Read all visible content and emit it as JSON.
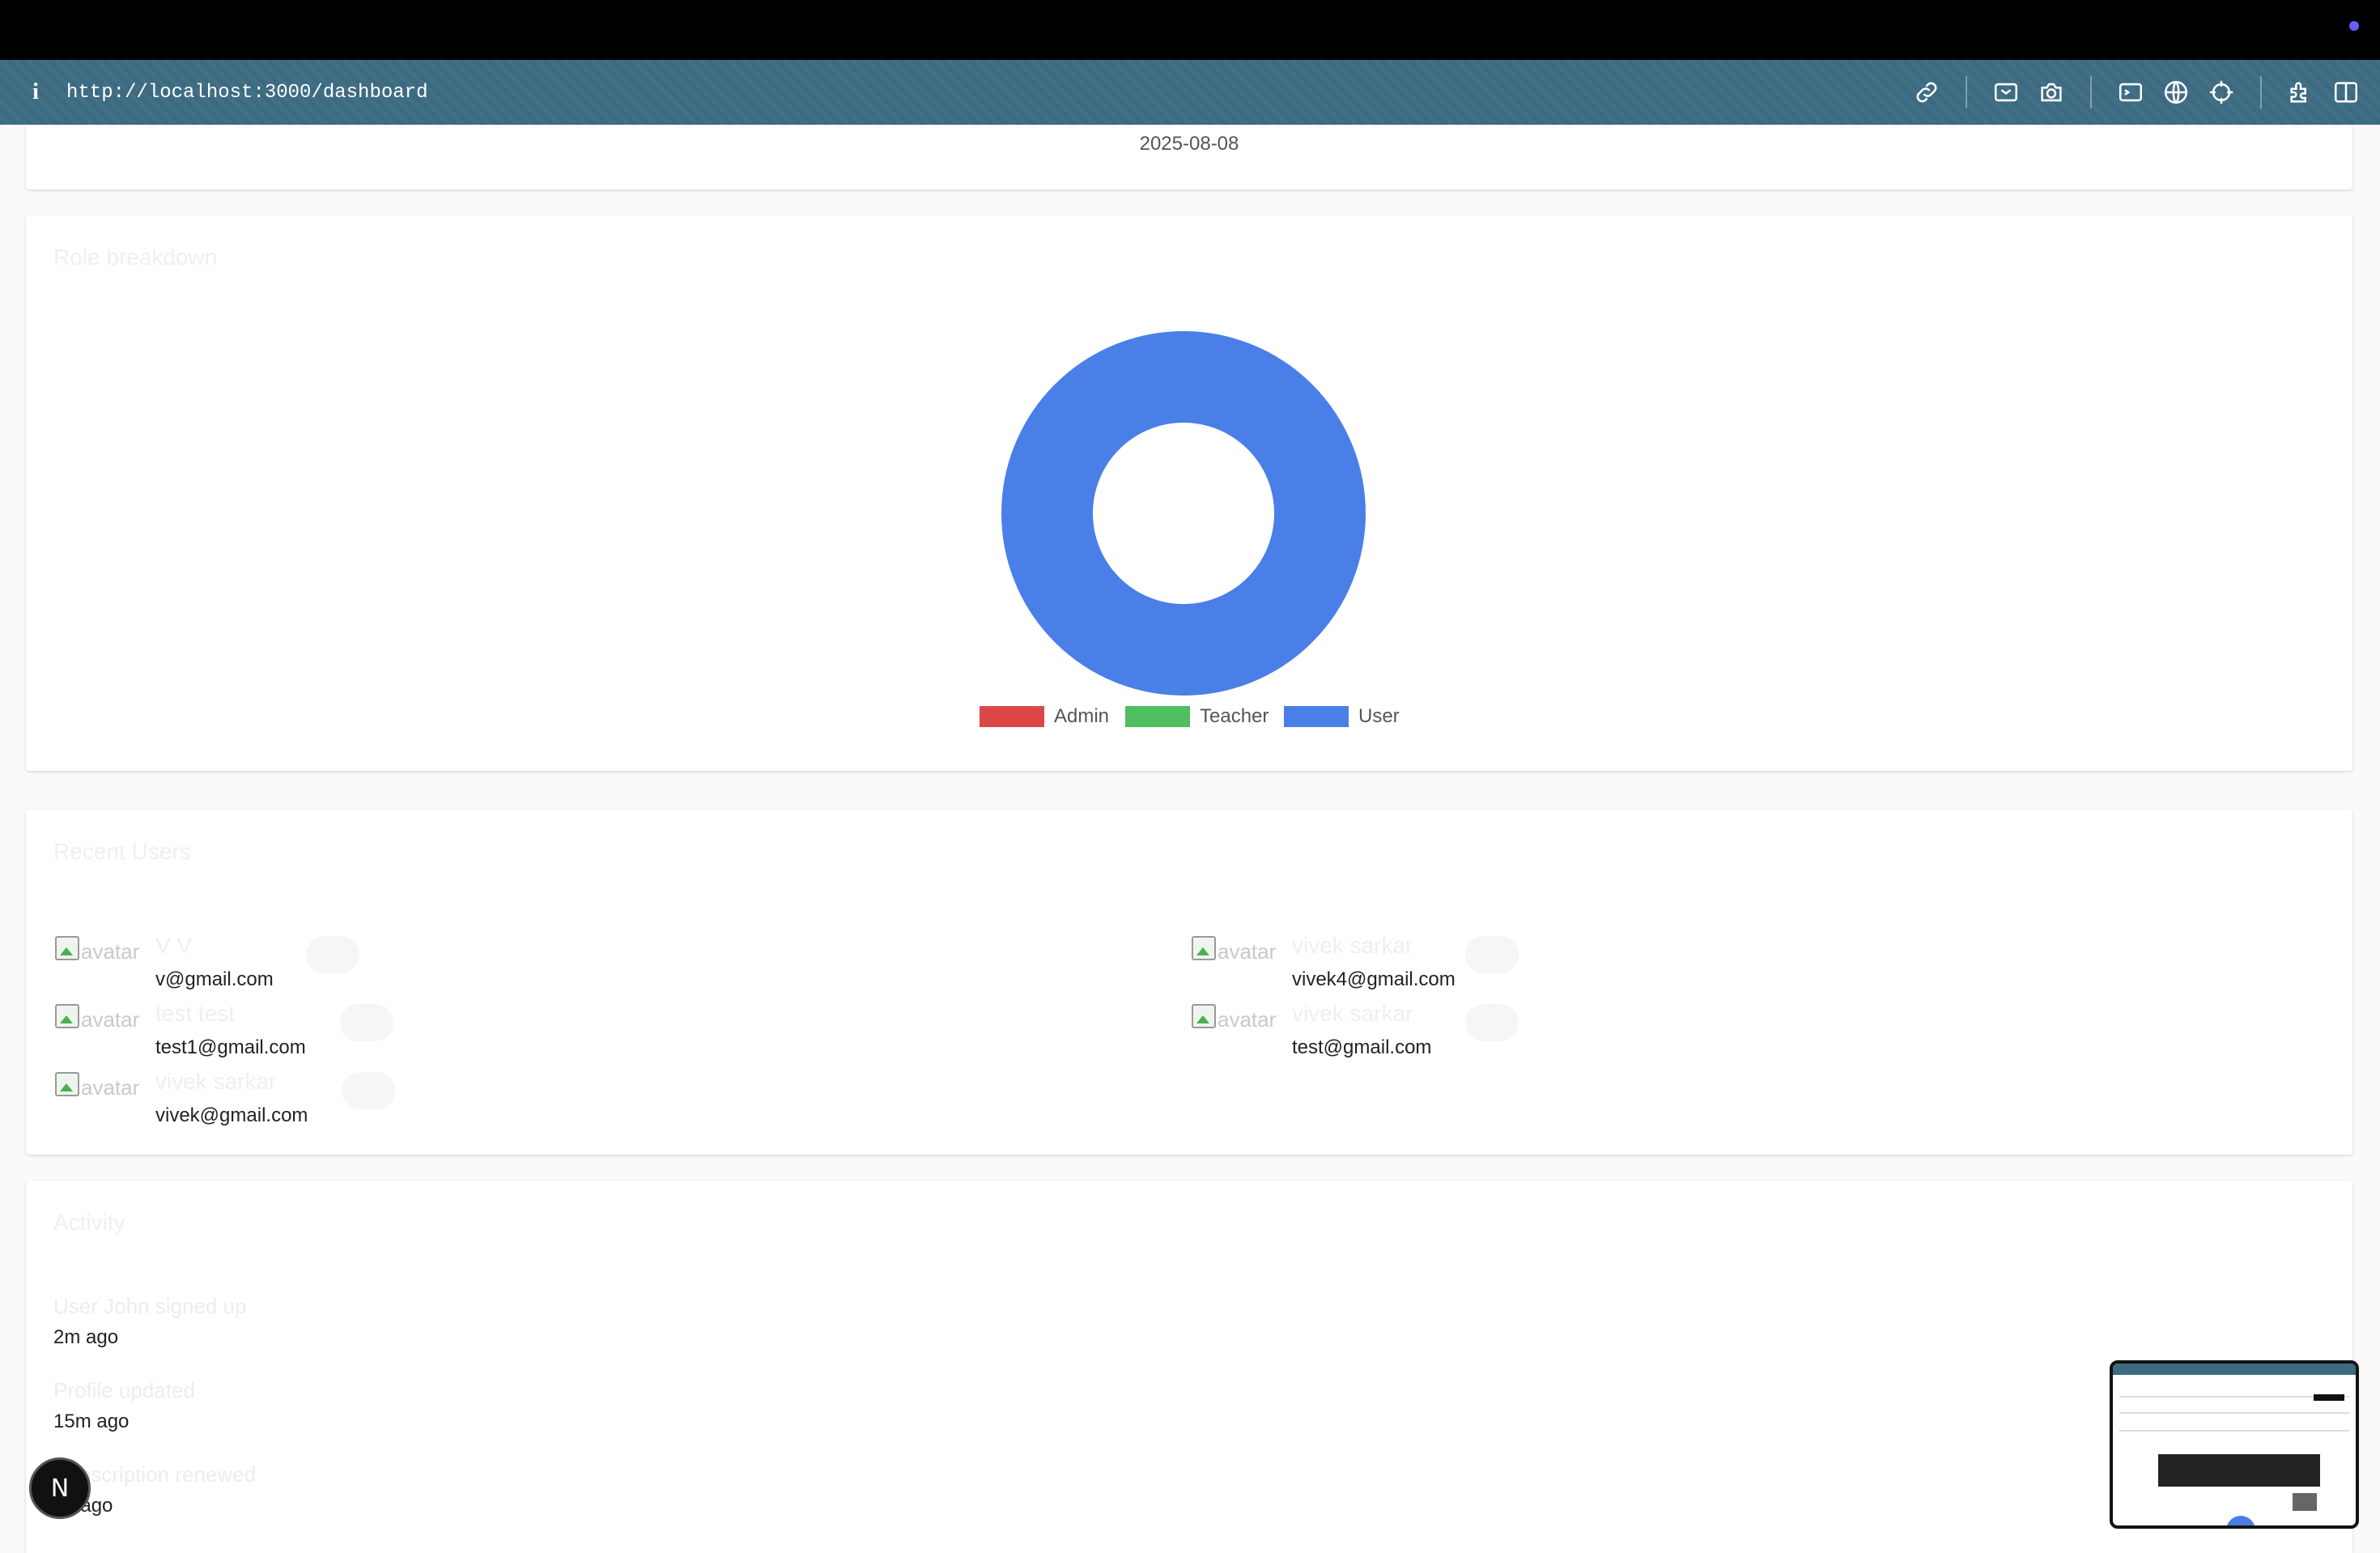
{
  "browser": {
    "info_glyph": "i",
    "url": "http://localhost:3000/dashboard",
    "tools": [
      "link-icon",
      "screenshot-area-icon",
      "camera-icon",
      "terminal-icon",
      "globe-icon",
      "crosshair-icon",
      "extension-icon",
      "split-view-icon"
    ]
  },
  "header_card": {
    "date": "2025-08-08"
  },
  "role_breakdown": {
    "title": "Role breakdown",
    "legend": [
      {
        "label": "Admin",
        "color": "#dc4848"
      },
      {
        "label": "Teacher",
        "color": "#4fbf5f"
      },
      {
        "label": "User",
        "color": "#4a7fe8"
      }
    ]
  },
  "chart_data": {
    "type": "pie",
    "title": "Role breakdown",
    "categories": [
      "Admin",
      "Teacher",
      "User"
    ],
    "values": [
      0,
      0,
      1
    ],
    "colors": [
      "#dc4848",
      "#4fbf5f",
      "#4a7fe8"
    ],
    "legend_position": "bottom"
  },
  "recent_users": {
    "title": "Recent Users",
    "avatar_alt": "avatar",
    "left": [
      {
        "name": "V V",
        "email": "v@gmail.com"
      },
      {
        "name": "test test",
        "email": "test1@gmail.com"
      },
      {
        "name": "vivek sarkar",
        "email": "vivek@gmail.com"
      }
    ],
    "right": [
      {
        "name": "vivek sarkar",
        "email": "vivek4@gmail.com"
      },
      {
        "name": "vivek sarkar",
        "email": "test@gmail.com"
      }
    ]
  },
  "activity": {
    "title": "Activity",
    "items": [
      {
        "title": "User John signed up",
        "time": "2m ago"
      },
      {
        "title": "Profile updated",
        "time": "15m ago"
      },
      {
        "title": "Subscription renewed",
        "time": "1h ago"
      }
    ]
  },
  "dev_badge": {
    "label": "N"
  }
}
